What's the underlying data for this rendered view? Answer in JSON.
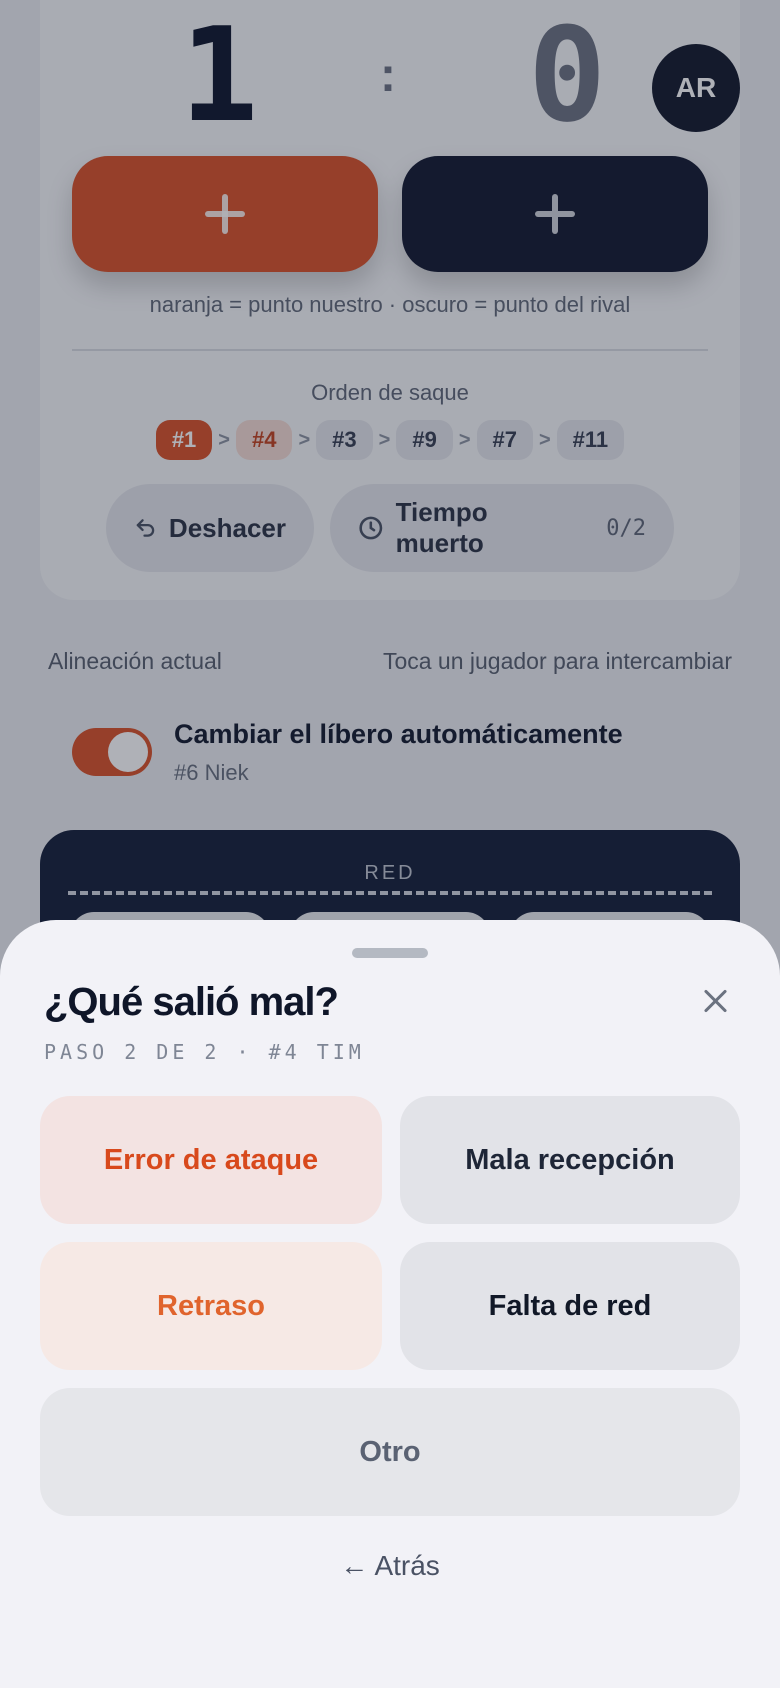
{
  "score": {
    "home": "1",
    "separator": ":",
    "away": "0"
  },
  "avatar": {
    "initials": "AR"
  },
  "add_point": {
    "home_icon": "plus-icon",
    "away_icon": "plus-icon"
  },
  "legend": "naranja = punto nuestro · oscuro = punto del rival",
  "serve_order": {
    "title": "Orden de saque",
    "players": [
      "#1",
      "#4",
      "#3",
      "#9",
      "#7",
      "#11"
    ],
    "separator": ">"
  },
  "actions": {
    "undo_label": "Deshacer",
    "timeout_label": "Tiempo muerto",
    "timeout_count": "0/2"
  },
  "lineup": {
    "title": "Alineación actual",
    "hint": "Toca un jugador para intercambiar"
  },
  "libero": {
    "toggle_label": "Cambiar el líbero automáticamente",
    "player": "#6 Niek",
    "enabled": true
  },
  "court": {
    "net_label": "RED"
  },
  "sheet": {
    "title": "¿Qué salió mal?",
    "step": "PASO 2 DE 2 · #4 TIM",
    "options": {
      "attack_error": "Error de ataque",
      "bad_reception": "Mala recepción",
      "delay": "Retraso",
      "net_fault": "Falta de red",
      "other": "Otro"
    },
    "back_label": "← Atrás"
  },
  "colors": {
    "accent": "#d9532a",
    "dark": "#141b31",
    "sheet_bg": "#f2f2f7"
  }
}
